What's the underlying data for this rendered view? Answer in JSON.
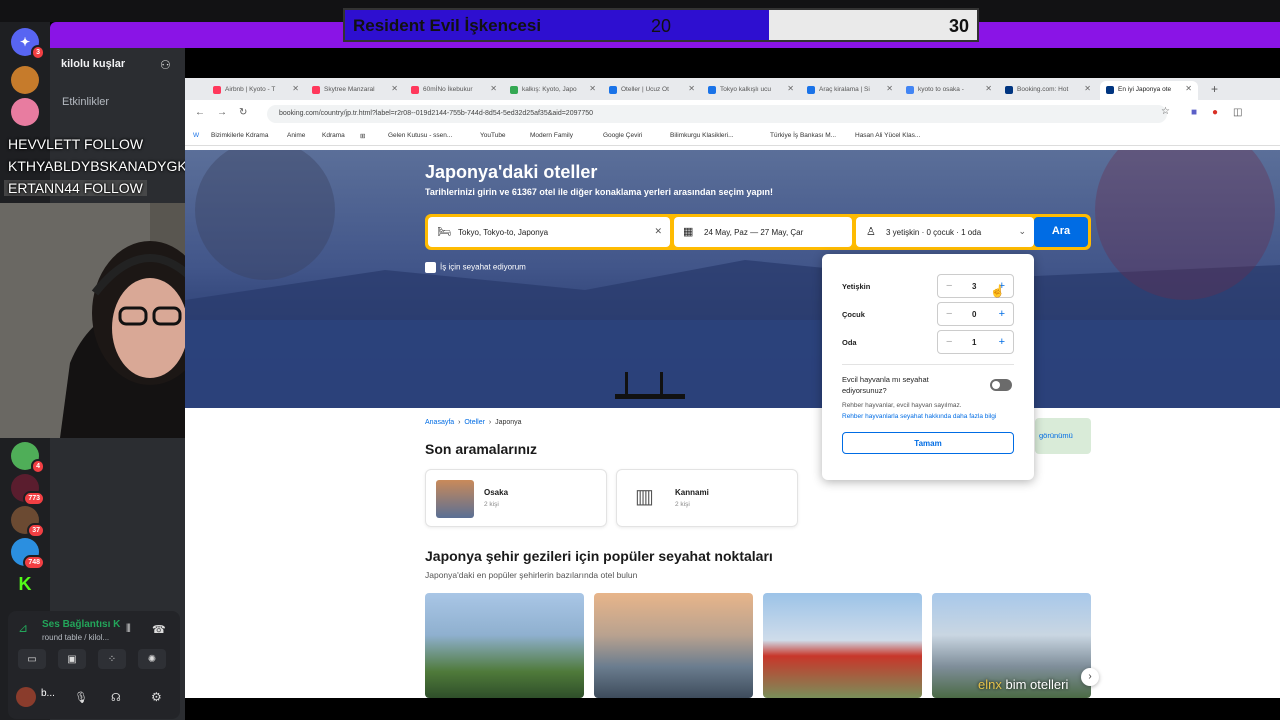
{
  "vote": {
    "title": "Resident Evil İşkencesi",
    "left_value": "20",
    "right_value": "30"
  },
  "discord": {
    "server_name": "kilolu kuşlar",
    "events_label": "Etkinlikler",
    "badges": [
      "3",
      "4",
      "773",
      "37",
      "748"
    ],
    "voice_status": "Ses Bağlantısı K",
    "voice_channel": "round table / kilol...",
    "user_name": "b..."
  },
  "chat": [
    "HEVVLETT  FOLLOW",
    "KTHYABLDYBSKANADYGKHNAKSN  FOLLOW",
    "ERTANN44  FOLLOW"
  ],
  "browser": {
    "tabs": [
      {
        "label": "Airbnb | Kyoto - T",
        "color": "#ff385c"
      },
      {
        "label": "Skytree Manzaral",
        "color": "#ff385c"
      },
      {
        "label": "60mİNo İkebukur",
        "color": "#ff385c"
      },
      {
        "label": "kalkış: Kyoto, Japo",
        "color": "#34a853"
      },
      {
        "label": "Oteller | Ucuz Ot",
        "color": "#1a73e8"
      },
      {
        "label": "Tokyo kalkışlı ucu",
        "color": "#1a73e8"
      },
      {
        "label": "Araç kiralama | Si",
        "color": "#1a73e8"
      },
      {
        "label": "kyoto to osaka -",
        "color": "#4285f4"
      },
      {
        "label": "Booking.com: Hot",
        "color": "#003580"
      },
      {
        "label": "En iyi Japonya ote",
        "color": "#003580"
      }
    ],
    "url": "booking.com/country/jp.tr.html?label=r2r08--019d2144-755b-744d-8d54-5ed32d25af35&aid=2097750",
    "bookmarks": [
      "Bizimkilerle Kdrama",
      "Anime",
      "Kdrama",
      "Gelen Kutusu - ssen...",
      "YouTube",
      "Modern Family",
      "Google Çeviri",
      "Bilimkurgu Klasikleri...",
      "Türkiye İş Bankası M...",
      "Hasan Ali Yücel Klas..."
    ]
  },
  "hero": {
    "title": "Japonya'daki oteller",
    "subtitle": "Tarihlerinizi girin ve 61367 otel ile diğer konaklama yerleri arasından seçim yapın!",
    "destination": "Tokyo, Tokyo-to, Japonya",
    "dates": "24 May, Paz  —  27 May, Çar",
    "occupancy": "3 yetişkin · 0 çocuk · 1 oda",
    "search_label": "Ara",
    "business_trip": "İş için seyahat ediyorum"
  },
  "occupancy_popup": {
    "adults_label": "Yetişkin",
    "adults": "3",
    "children_label": "Çocuk",
    "children": "0",
    "rooms_label": "Oda",
    "rooms": "1",
    "pet_question": "Evcil hayvanla mı seyahat ediyorsunuz?",
    "pet_note": "Rehber hayvanlar, evcil hayvan sayılmaz.",
    "pet_link": "Rehber hayvanlarla seyahat hakkında daha fazla bilgi",
    "done_label": "Tamam"
  },
  "breadcrumb": [
    "Anasayfa",
    "Oteller",
    "Japonya"
  ],
  "recent": {
    "title": "Son aramalarınız",
    "items": [
      {
        "city": "Osaka",
        "people": "2 kişi"
      },
      {
        "city": "Kannami",
        "people": "2 kişi"
      }
    ]
  },
  "map_label": "görünümü",
  "popular": {
    "title": "Japonya şehir gezileri için popüler seyahat noktaları",
    "subtitle": "Japonya'daki en popüler şehirlerin bazılarında otel bulun"
  },
  "caption": {
    "name": "elnx",
    "text": "bim otelleri"
  }
}
